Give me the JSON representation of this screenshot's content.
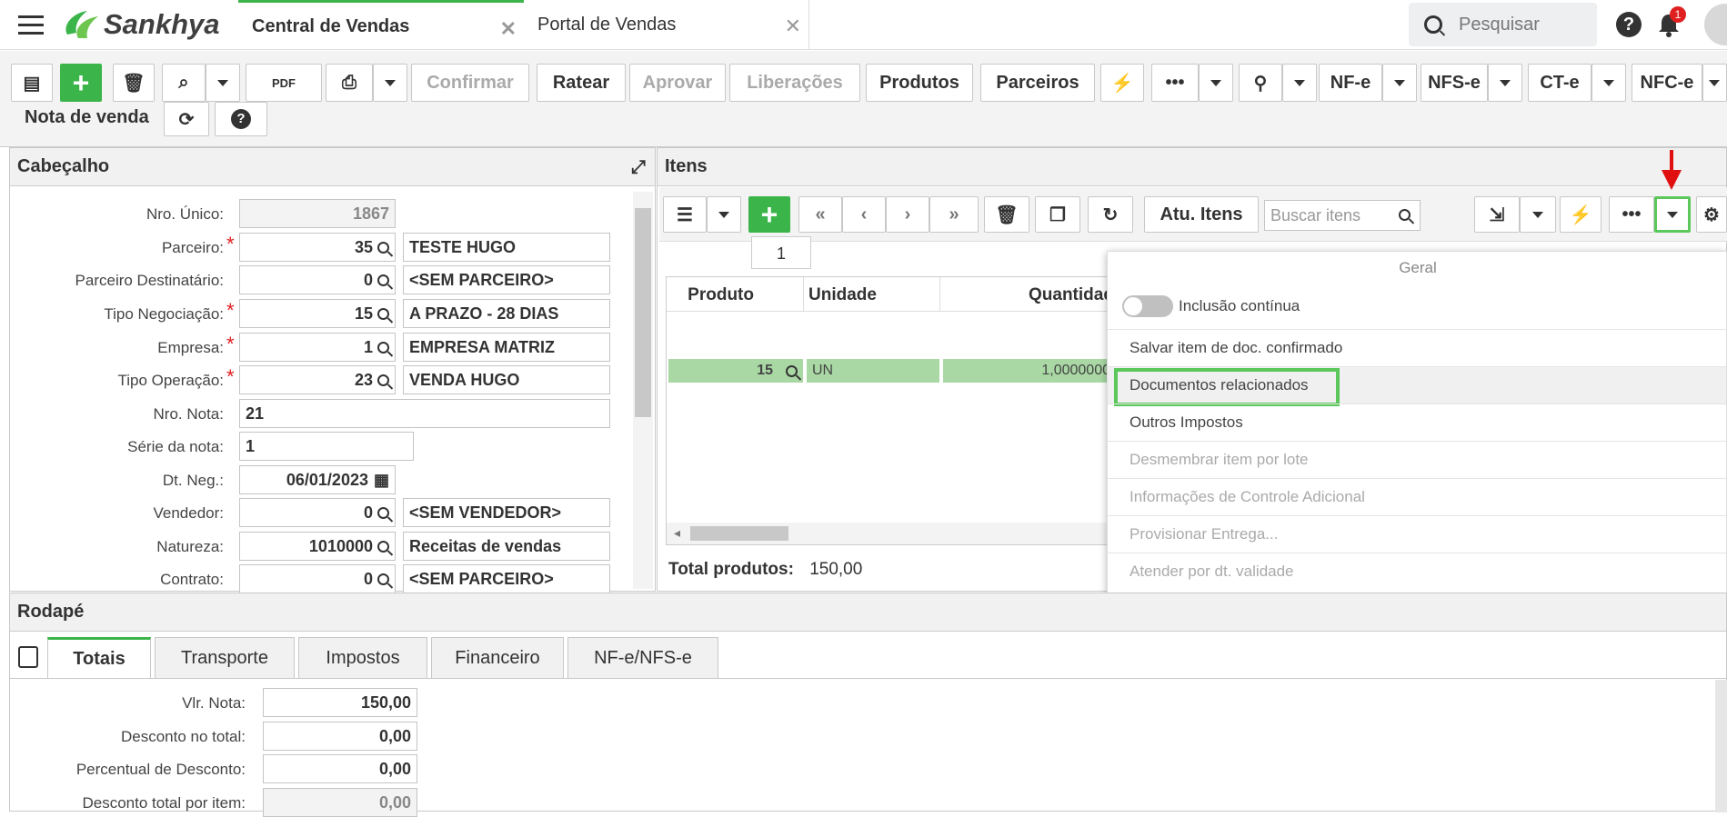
{
  "app": {
    "brand": "Sankhya",
    "notifications": "1",
    "search_placeholder": "Pesquisar"
  },
  "tabs": [
    {
      "label": "Central de Vendas"
    },
    {
      "label": "Portal de Vendas"
    }
  ],
  "toolbar": {
    "confirmar": "Confirmar",
    "ratear": "Ratear",
    "aprovar": "Aprovar",
    "liberacoes": "Liberações",
    "produtos": "Produtos",
    "parceiros": "Parceiros",
    "nfe": "NF-e",
    "nfse": "NFS-e",
    "cte": "CT-e",
    "nfce": "NFC-e",
    "doc_type": "Nota de venda"
  },
  "header": {
    "title": "Cabeçalho",
    "fields": [
      {
        "label": "Nro. Único:",
        "value": "1867",
        "desc": ""
      },
      {
        "label": "Parceiro:",
        "value": "35",
        "desc": "TESTE HUGO"
      },
      {
        "label": "Parceiro Destinatário:",
        "value": "0",
        "desc": "<SEM PARCEIRO>"
      },
      {
        "label": "Tipo Negociação:",
        "value": "15",
        "desc": "A PRAZO - 28 DIAS"
      },
      {
        "label": "Empresa:",
        "value": "1",
        "desc": "EMPRESA MATRIZ"
      },
      {
        "label": "Tipo Operação:",
        "value": "23",
        "desc": "VENDA HUGO"
      },
      {
        "label": "Nro. Nota:",
        "value": "21",
        "desc": ""
      },
      {
        "label": "Série da nota:",
        "value": "1",
        "desc": ""
      },
      {
        "label": "Dt. Neg.:",
        "value": "06/01/2023",
        "desc": ""
      },
      {
        "label": "Vendedor:",
        "value": "0",
        "desc": "<SEM VENDEDOR>"
      },
      {
        "label": "Natureza:",
        "value": "1010000",
        "desc": "Receitas de vendas"
      },
      {
        "label": "Contrato:",
        "value": "0",
        "desc": "<SEM PARCEIRO>"
      }
    ]
  },
  "items": {
    "title": "Itens",
    "atu_label": "Atu. Itens",
    "search_placeholder": "Buscar itens",
    "page": "1",
    "columns": [
      "Produto",
      "Unidade",
      "Quantidade"
    ],
    "row": {
      "produto": "15",
      "unidade": "UN",
      "quantidade": "1,0000000"
    },
    "total_label": "Total produtos:",
    "total_value": "150,00"
  },
  "menu": {
    "header": "Geral",
    "toggle_label": "Inclusão contínua",
    "items": [
      {
        "label": "Salvar item de doc. confirmado"
      },
      {
        "label": "Documentos relacionados"
      },
      {
        "label": "Outros Impostos"
      },
      {
        "label": "Desmembrar item por lote"
      },
      {
        "label": "Informações de Controle Adicional"
      },
      {
        "label": "Provisionar Entrega..."
      },
      {
        "label": "Atender por dt. validade"
      }
    ]
  },
  "footer": {
    "title": "Rodapé",
    "tabs": [
      "Totais",
      "Transporte",
      "Impostos",
      "Financeiro",
      "NF-e/NFS-e"
    ],
    "fields": [
      {
        "label": "Vlr. Nota:",
        "value": "150,00"
      },
      {
        "label": "Desconto no total:",
        "value": "0,00"
      },
      {
        "label": "Percentual de Desconto:",
        "value": "0,00"
      },
      {
        "label": "Desconto total por item:",
        "value": "0,00"
      }
    ]
  },
  "colors": {
    "accent": "#3bb54a",
    "highlight": "#5cc85c",
    "arrow": "#e01010",
    "row_bg": "#a9d8a4"
  }
}
